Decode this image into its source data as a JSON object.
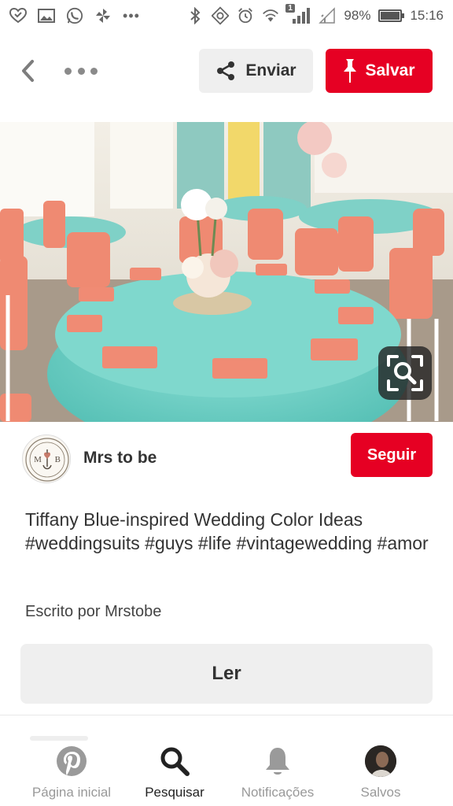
{
  "status_bar": {
    "battery": "98%",
    "battery_level": 0.98,
    "time": "15:16",
    "signal_badge": "1",
    "left_icons": [
      "heart-check-icon",
      "image-icon",
      "whatsapp-icon",
      "pinwheel-icon",
      "more-dots-icon"
    ],
    "right_icons": [
      "bluetooth-icon",
      "nfc-icon",
      "alarm-icon",
      "wifi-icon",
      "signal-icon",
      "battery-icon"
    ]
  },
  "header": {
    "share_label": "Enviar",
    "save_label": "Salvar"
  },
  "pin": {
    "image_description_icon": "visual-search-icon",
    "pinner_name": "Mrs to be",
    "avatar_initials": "M B",
    "follow_label": "Seguir",
    "description": "Tiffany Blue-inspired Wedding Color Ideas #weddingsuits  #guys   #life #vintagewedding  #amor",
    "author": "Escrito por Mrstobe",
    "read_label": "Ler"
  },
  "bottom_nav": {
    "items": [
      {
        "label": "Página inicial",
        "icon": "pinterest-logo-icon"
      },
      {
        "label": "Pesquisar",
        "icon": "search-icon"
      },
      {
        "label": "Notificações",
        "icon": "bell-icon"
      },
      {
        "label": "Salvos",
        "icon": "profile-avatar"
      }
    ],
    "active_index": 1
  },
  "colors": {
    "brand_red": "#e60023",
    "tiffany": "#6ccdc4",
    "coral": "#ef8a72"
  }
}
